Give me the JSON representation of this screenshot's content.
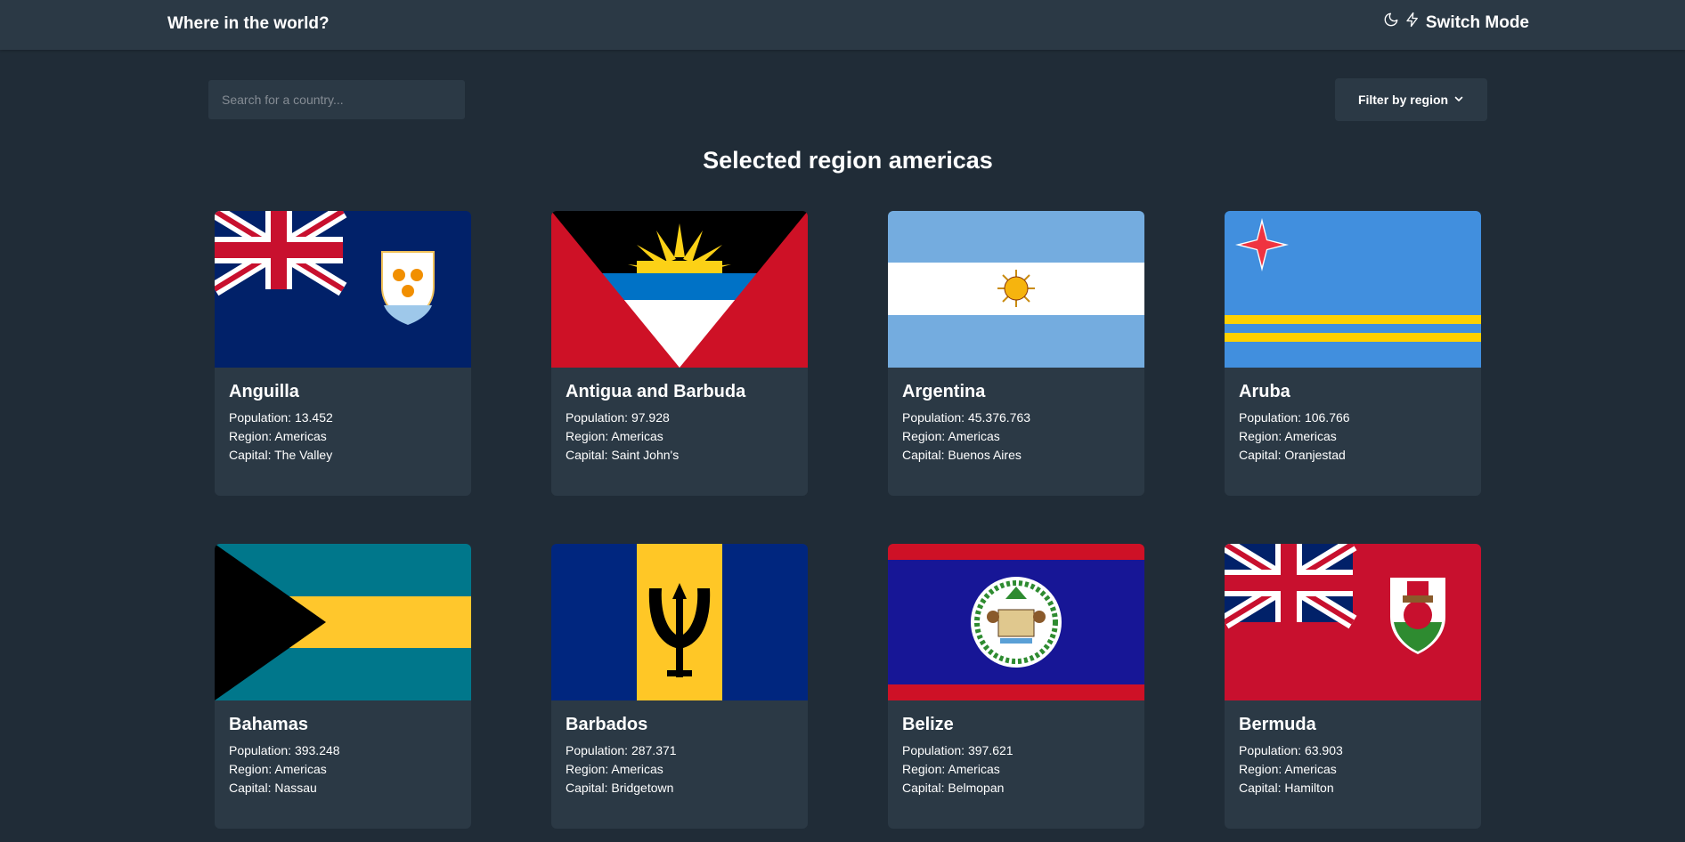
{
  "app": {
    "title": "Where in the world?",
    "switch_mode_label": "Switch Mode",
    "icons": [
      "moon-icon",
      "bolt-icon"
    ]
  },
  "search": {
    "placeholder": "Search for a country...",
    "value": ""
  },
  "filter": {
    "label": "Filter by region",
    "icon": "chevron-down-icon"
  },
  "heading": "Selected region americas",
  "labels": {
    "population": "Population:",
    "region": "Region:",
    "capital": "Capital:"
  },
  "countries": [
    {
      "name": "Anguilla",
      "population": "13.452",
      "region": "Americas",
      "capital": "The Valley",
      "flag": "flag-anguilla"
    },
    {
      "name": "Antigua and Barbuda",
      "population": "97.928",
      "region": "Americas",
      "capital": "Saint John's",
      "flag": "flag-antigua-and-barbuda"
    },
    {
      "name": "Argentina",
      "population": "45.376.763",
      "region": "Americas",
      "capital": "Buenos Aires",
      "flag": "flag-argentina"
    },
    {
      "name": "Aruba",
      "population": "106.766",
      "region": "Americas",
      "capital": "Oranjestad",
      "flag": "flag-aruba"
    },
    {
      "name": "Bahamas",
      "population": "393.248",
      "region": "Americas",
      "capital": "Nassau",
      "flag": "flag-bahamas"
    },
    {
      "name": "Barbados",
      "population": "287.371",
      "region": "Americas",
      "capital": "Bridgetown",
      "flag": "flag-barbados"
    },
    {
      "name": "Belize",
      "population": "397.621",
      "region": "Americas",
      "capital": "Belmopan",
      "flag": "flag-belize"
    },
    {
      "name": "Bermuda",
      "population": "63.903",
      "region": "Americas",
      "capital": "Hamilton",
      "flag": "flag-bermuda"
    }
  ],
  "colors": {
    "background": "#202c37",
    "surface": "#2b3945",
    "text": "#ffffff",
    "placeholder": "#858c94"
  }
}
